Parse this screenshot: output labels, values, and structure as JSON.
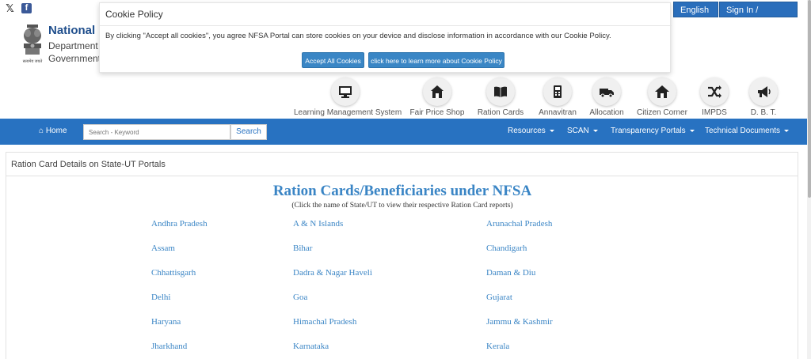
{
  "social": {
    "x_label": "𝕏",
    "fb_label": "f"
  },
  "header": {
    "language_label": "English",
    "sign_label": "Sign In / Register",
    "site_name": "National Food Security Portal",
    "site_sub1": "Department of Food & Public Distribution",
    "site_sub2": "Government of India",
    "emblem_caption": "सत्यमेव जयते"
  },
  "cookie": {
    "title": "Cookie Policy",
    "text": "By clicking \"Accept all cookies\", you agree NFSA Portal can store cookies on your device and disclose information in accordance with our Cookie Policy.",
    "accept_label": "Accept All Cookies",
    "learn_label": "click here to learn more about Cookie Policy"
  },
  "icon_nav": [
    {
      "label": "Learning Management System",
      "icon": "monitor-icon"
    },
    {
      "label": "Fair Price Shop",
      "icon": "shop-icon"
    },
    {
      "label": "Ration Cards",
      "icon": "book-icon"
    },
    {
      "label": "Annavitran",
      "icon": "device-icon"
    },
    {
      "label": "Allocation",
      "icon": "truck-icon"
    },
    {
      "label": "Citizen Corner",
      "icon": "house-icon"
    },
    {
      "label": "IMPDS",
      "icon": "shuffle-icon"
    },
    {
      "label": "D. B. T.",
      "icon": "megaphone-icon"
    }
  ],
  "navbar": {
    "home_label": "Home",
    "search_placeholder": "Search - Keyword",
    "search_button": "Search",
    "menus": [
      "Resources",
      "SCAN",
      "Transparency Portals",
      "Technical Documents"
    ]
  },
  "content": {
    "breadcrumb": "Ration Card Details on State-UT Portals",
    "title": "Ration Cards/Beneficiaries under NFSA",
    "subtitle": "(Click the name of State/UT to view their respective Ration Card reports)",
    "states": [
      [
        "Andhra Pradesh",
        "A & N Islands",
        "Arunachal Pradesh"
      ],
      [
        "Assam",
        "Bihar",
        "Chandigarh"
      ],
      [
        "Chhattisgarh",
        "Dadra & Nagar Haveli",
        "Daman & Diu"
      ],
      [
        "Delhi",
        "Goa",
        "Gujarat"
      ],
      [
        "Haryana",
        "Himachal Pradesh",
        "Jammu & Kashmir"
      ],
      [
        "Jharkhand",
        "Karnataka",
        "Kerala"
      ]
    ]
  }
}
